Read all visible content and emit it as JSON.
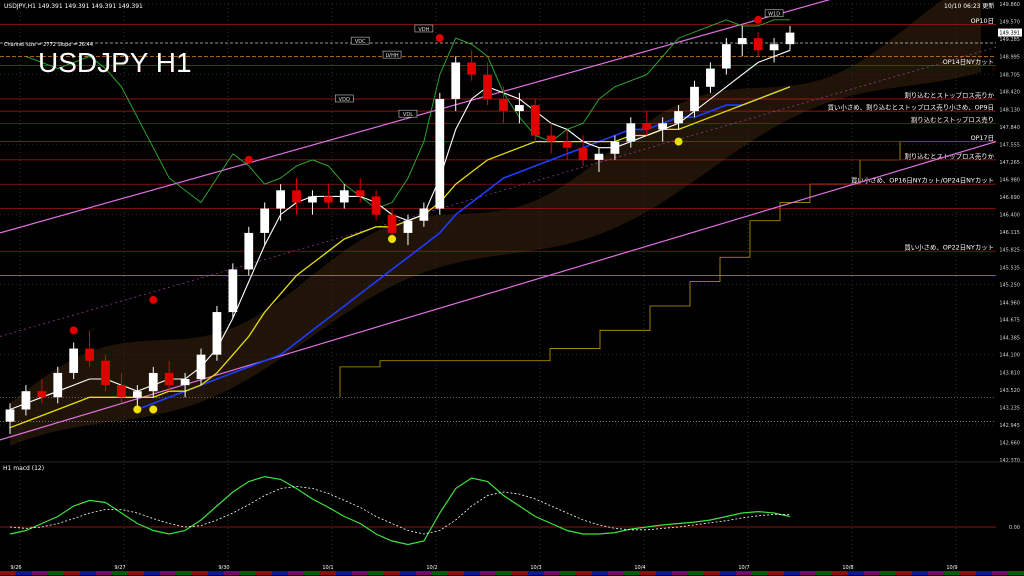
{
  "header": {
    "symbol_info": "USDJPY,H1  149.391 149.391 149.391 149.391",
    "channel_info": "Channel size = 2772 Slope = 26.44",
    "big_title": "USDJPY H1",
    "timestamp": "10/10 06:23 更新"
  },
  "colors": {
    "background": "#000000",
    "bull_candle": "#ffffff",
    "bear_candle": "#e00000",
    "ma_white": "#ffffff",
    "ma_yellow": "#e8e000",
    "ma_blue": "#1e3cff",
    "channel": "#e070e0",
    "kumo": "#c08040",
    "macd_main": "#40e040",
    "macd_signal": "#ffffff",
    "hline_red": "#c01818",
    "green_line": "#30b030"
  },
  "chart_data": {
    "type": "line",
    "title": "USDJPY H1",
    "ylim": [
      142.37,
      149.86
    ],
    "price_ticks": [
      "149.860",
      "149.570",
      "149.285",
      "148.995",
      "148.705",
      "148.420",
      "148.130",
      "147.840",
      "147.555",
      "147.265",
      "146.980",
      "146.690",
      "146.400",
      "146.115",
      "145.825",
      "145.535",
      "145.250",
      "144.960",
      "144.675",
      "144.385",
      "144.100",
      "143.810",
      "143.520",
      "143.235",
      "142.945",
      "142.660",
      "142.370"
    ],
    "x_tick_labels": [
      "9/26",
      "9/27",
      "9/30",
      "10/1",
      "10/2",
      "10/3",
      "10/4",
      "10/7",
      "10/8",
      "10/9"
    ],
    "current_price": "149.391",
    "candles": [
      [
        143.0,
        143.3,
        142.8,
        143.2
      ],
      [
        143.2,
        143.6,
        143.1,
        143.5
      ],
      [
        143.5,
        143.7,
        143.3,
        143.4
      ],
      [
        143.4,
        143.9,
        143.3,
        143.8
      ],
      [
        143.8,
        144.3,
        143.7,
        144.2
      ],
      [
        144.2,
        144.5,
        143.9,
        144.0
      ],
      [
        144.0,
        144.1,
        143.5,
        143.6
      ],
      [
        143.6,
        143.8,
        143.3,
        143.4
      ],
      [
        143.4,
        143.6,
        143.2,
        143.5
      ],
      [
        143.5,
        143.9,
        143.4,
        143.8
      ],
      [
        143.8,
        144.0,
        143.5,
        143.6
      ],
      [
        143.6,
        143.8,
        143.4,
        143.7
      ],
      [
        143.7,
        144.2,
        143.6,
        144.1
      ],
      [
        144.1,
        144.9,
        144.0,
        144.8
      ],
      [
        144.8,
        145.6,
        144.7,
        145.5
      ],
      [
        145.5,
        146.2,
        145.4,
        146.1
      ],
      [
        146.1,
        146.6,
        145.9,
        146.5
      ],
      [
        146.5,
        146.9,
        146.3,
        146.8
      ],
      [
        146.8,
        147.0,
        146.4,
        146.6
      ],
      [
        146.6,
        146.8,
        146.4,
        146.7
      ],
      [
        146.7,
        146.9,
        146.5,
        146.6
      ],
      [
        146.6,
        146.9,
        146.5,
        146.8
      ],
      [
        146.8,
        147.0,
        146.6,
        146.7
      ],
      [
        146.7,
        146.8,
        146.3,
        146.4
      ],
      [
        146.4,
        146.5,
        146.0,
        146.1
      ],
      [
        146.1,
        146.4,
        145.9,
        146.3
      ],
      [
        146.3,
        146.6,
        146.2,
        146.5
      ],
      [
        146.5,
        148.4,
        146.4,
        148.3
      ],
      [
        148.3,
        149.0,
        148.1,
        148.9
      ],
      [
        148.9,
        149.1,
        148.6,
        148.7
      ],
      [
        148.7,
        148.9,
        148.2,
        148.3
      ],
      [
        148.3,
        148.5,
        147.9,
        148.1
      ],
      [
        148.1,
        148.4,
        147.9,
        148.2
      ],
      [
        148.2,
        148.3,
        147.6,
        147.7
      ],
      [
        147.7,
        147.9,
        147.4,
        147.6
      ],
      [
        147.6,
        147.8,
        147.3,
        147.5
      ],
      [
        147.5,
        147.7,
        147.2,
        147.3
      ],
      [
        147.3,
        147.5,
        147.1,
        147.4
      ],
      [
        147.4,
        147.7,
        147.3,
        147.6
      ],
      [
        147.6,
        148.0,
        147.5,
        147.9
      ],
      [
        147.9,
        148.1,
        147.7,
        147.8
      ],
      [
        147.8,
        148.0,
        147.6,
        147.9
      ],
      [
        147.9,
        148.2,
        147.8,
        148.1
      ],
      [
        148.1,
        148.6,
        148.0,
        148.5
      ],
      [
        148.5,
        148.9,
        148.4,
        148.8
      ],
      [
        148.8,
        149.3,
        148.7,
        149.2
      ],
      [
        149.2,
        149.5,
        149.0,
        149.3
      ],
      [
        149.3,
        149.4,
        149.0,
        149.1
      ],
      [
        149.1,
        149.3,
        148.9,
        149.2
      ],
      [
        149.2,
        149.5,
        149.1,
        149.39
      ]
    ],
    "ma_white": [
      143.2,
      143.3,
      143.4,
      143.5,
      143.6,
      143.7,
      143.7,
      143.6,
      143.5,
      143.6,
      143.7,
      143.7,
      143.9,
      144.2,
      144.7,
      145.3,
      145.9,
      146.4,
      146.6,
      146.7,
      146.7,
      146.7,
      146.7,
      146.6,
      146.4,
      146.3,
      146.4,
      147.0,
      147.8,
      148.3,
      148.5,
      148.4,
      148.3,
      148.1,
      147.9,
      147.8,
      147.6,
      147.5,
      147.5,
      147.6,
      147.7,
      147.8,
      147.9,
      148.1,
      148.3,
      148.5,
      148.7,
      148.9,
      149.0,
      149.1
    ],
    "ma_yellow": [
      142.9,
      143.0,
      143.1,
      143.2,
      143.3,
      143.4,
      143.4,
      143.4,
      143.4,
      143.4,
      143.5,
      143.5,
      143.6,
      143.8,
      144.1,
      144.4,
      144.8,
      145.1,
      145.4,
      145.6,
      145.8,
      146.0,
      146.1,
      146.2,
      146.2,
      146.3,
      146.4,
      146.6,
      146.9,
      147.1,
      147.3,
      147.4,
      147.5,
      147.6,
      147.6,
      147.6,
      147.6,
      147.6,
      147.6,
      147.7,
      147.7,
      147.8,
      147.8,
      147.9,
      148.0,
      148.1,
      148.2,
      148.3,
      148.4,
      148.5
    ],
    "ma_blue": [
      null,
      null,
      null,
      null,
      null,
      null,
      null,
      null,
      143.2,
      143.3,
      143.4,
      143.5,
      143.6,
      143.7,
      143.8,
      143.9,
      144.0,
      144.1,
      144.3,
      144.5,
      144.7,
      144.9,
      145.1,
      145.3,
      145.5,
      145.7,
      145.9,
      146.1,
      146.4,
      146.6,
      146.8,
      147.0,
      147.1,
      147.2,
      147.3,
      147.4,
      147.5,
      147.6,
      147.7,
      147.8,
      147.8,
      147.9,
      148.0,
      148.0,
      148.1,
      148.2,
      148.2,
      148.3,
      148.4,
      148.5
    ],
    "green_line": [
      null,
      149.0,
      148.9,
      148.8,
      148.9,
      149.0,
      148.8,
      148.5,
      148.0,
      147.5,
      147.0,
      146.8,
      146.6,
      147.0,
      147.4,
      147.2,
      146.9,
      147.0,
      147.2,
      147.3,
      147.2,
      146.9,
      146.7,
      146.5,
      146.6,
      147.0,
      147.6,
      148.7,
      149.3,
      149.2,
      149.0,
      148.4,
      148.0,
      147.7,
      147.6,
      147.8,
      147.9,
      148.3,
      148.5,
      148.6,
      148.7,
      149.0,
      149.3,
      149.4,
      149.5,
      149.6,
      149.5,
      149.5,
      149.6,
      149.6
    ],
    "channel": {
      "upper": [
        146.1,
        150.7
      ],
      "lower": [
        142.7,
        147.6
      ],
      "mid": [
        144.4,
        149.15
      ]
    },
    "levels": [
      {
        "price": 149.52,
        "label": "OP10日",
        "kind": "red"
      },
      {
        "price": 149.22,
        "label": "",
        "kind": "white-dash"
      },
      {
        "price": 149.0,
        "label": "",
        "kind": "orange-dash"
      },
      {
        "price": 148.85,
        "label": "OP14日NYカット",
        "kind": "red"
      },
      {
        "price": 148.3,
        "label": "割り込むとストップロス売りか",
        "kind": "red"
      },
      {
        "price": 148.1,
        "label": "買い小さめ、割り込むとストップロス売り小さめ、OP9日",
        "kind": "red"
      },
      {
        "price": 147.9,
        "label": "割り込むとストップロス売り",
        "kind": "red"
      },
      {
        "price": 147.6,
        "label": "OP17日",
        "kind": "red"
      },
      {
        "price": 147.3,
        "label": "割り込むとストップロス売りか",
        "kind": "red"
      },
      {
        "price": 146.9,
        "label": "買い小さめ、OP16日NYカット/OP24日NYカット",
        "kind": "red"
      },
      {
        "price": 146.5,
        "label": "",
        "kind": "red"
      },
      {
        "price": 145.8,
        "label": "買い小さめ、OP22日NYカット",
        "kind": "red"
      },
      {
        "price": 145.4,
        "label": "",
        "kind": "yellow"
      },
      {
        "price": 143.4,
        "label": "",
        "kind": "white-dot"
      },
      {
        "price": 143.0,
        "label": "",
        "kind": "white-dot"
      }
    ],
    "boxes": [
      {
        "label": "VDH",
        "i": 26,
        "price": 149.45
      },
      {
        "label": "VDC",
        "i": 22,
        "price": 149.25
      },
      {
        "label": "LVHH",
        "i": 24,
        "price": 149.02
      },
      {
        "label": "VDO",
        "i": 21,
        "price": 148.3
      },
      {
        "label": "VDL",
        "i": 25,
        "price": 148.05
      },
      {
        "label": "W1D",
        "i": 48,
        "price": 149.7
      }
    ],
    "macd": {
      "label": "H1 macd (12)",
      "zero_label": "0.00",
      "main": [
        -0.1,
        -0.05,
        0.05,
        0.15,
        0.3,
        0.38,
        0.35,
        0.2,
        0.05,
        -0.05,
        -0.1,
        -0.05,
        0.1,
        0.3,
        0.5,
        0.65,
        0.72,
        0.68,
        0.55,
        0.4,
        0.28,
        0.15,
        0.05,
        -0.1,
        -0.2,
        -0.25,
        -0.2,
        0.2,
        0.55,
        0.7,
        0.65,
        0.45,
        0.3,
        0.15,
        0.05,
        -0.05,
        -0.1,
        -0.1,
        -0.08,
        -0.03,
        0.0,
        0.03,
        0.05,
        0.07,
        0.1,
        0.15,
        0.2,
        0.22,
        0.2,
        0.15
      ],
      "signal": [
        0.0,
        -0.02,
        0.0,
        0.05,
        0.12,
        0.2,
        0.25,
        0.25,
        0.2,
        0.12,
        0.05,
        0.0,
        0.02,
        0.1,
        0.2,
        0.32,
        0.45,
        0.55,
        0.58,
        0.55,
        0.48,
        0.38,
        0.28,
        0.15,
        0.05,
        -0.05,
        -0.1,
        -0.05,
        0.1,
        0.3,
        0.45,
        0.5,
        0.47,
        0.4,
        0.3,
        0.2,
        0.1,
        0.03,
        -0.02,
        -0.04,
        -0.04,
        -0.02,
        0.0,
        0.03,
        0.06,
        0.09,
        0.13,
        0.16,
        0.18,
        0.18
      ]
    }
  }
}
